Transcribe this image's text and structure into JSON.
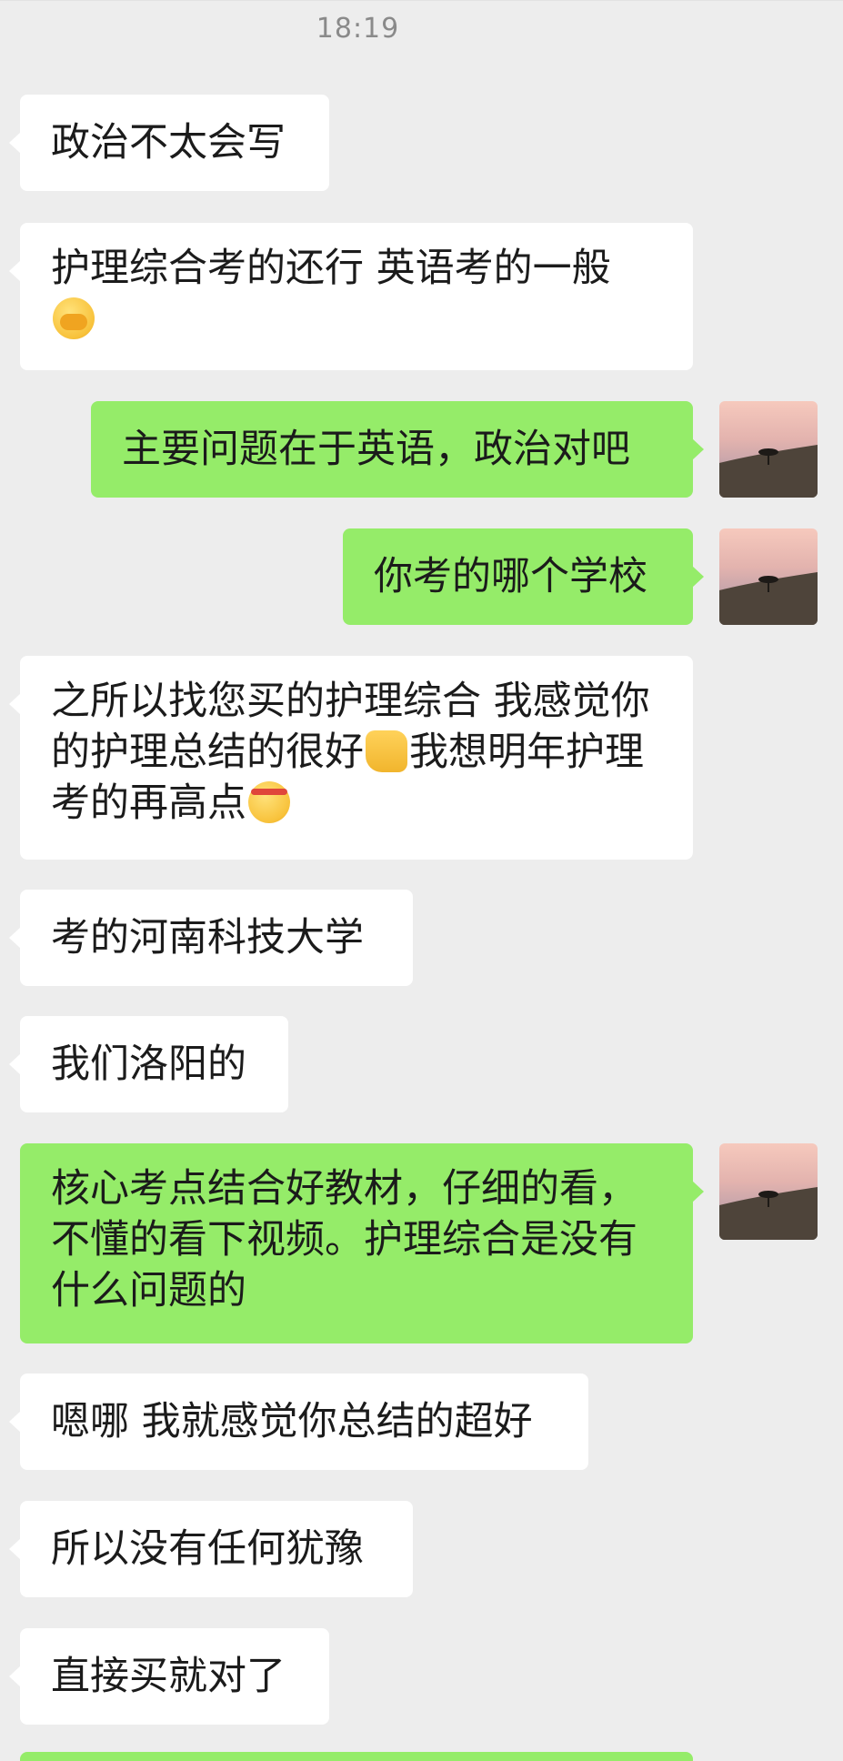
{
  "timestamp": "18:19",
  "messages": [
    {
      "text": "政治不太会写"
    },
    {
      "text": "护理综合考的还行 英语考的一般",
      "emoji": "face-palm-emoji"
    },
    {
      "text": "主要问题在于英语，政治对吧"
    },
    {
      "text": "你考的哪个学校"
    },
    {
      "line1": "之所以找您买的护理综合 我感觉你",
      "line2a": "的护理总结的很好",
      "emoji1": "thumbs-up-emoji",
      "line2b": "我想明年护理",
      "line3": "考的再高点",
      "emoji2": "determined-face-emoji"
    },
    {
      "text": "考的河南科技大学"
    },
    {
      "text": "我们洛阳的"
    },
    {
      "line1": "核心考点结合好教材，仔细的看，",
      "line2": "不懂的看下视频。护理综合是没有",
      "line3": "什么问题的"
    },
    {
      "text": "嗯哪 我就感觉你总结的超好"
    },
    {
      "text": "所以没有任何犹豫"
    },
    {
      "text": "直接买就对了"
    }
  ],
  "avatar": {
    "description_icon": "sunset-tree-avatar-icon"
  },
  "colors": {
    "background": "#ededed",
    "incoming_bubble": "#ffffff",
    "outgoing_bubble": "#95ec69",
    "timestamp_text": "#8a8a8a"
  }
}
